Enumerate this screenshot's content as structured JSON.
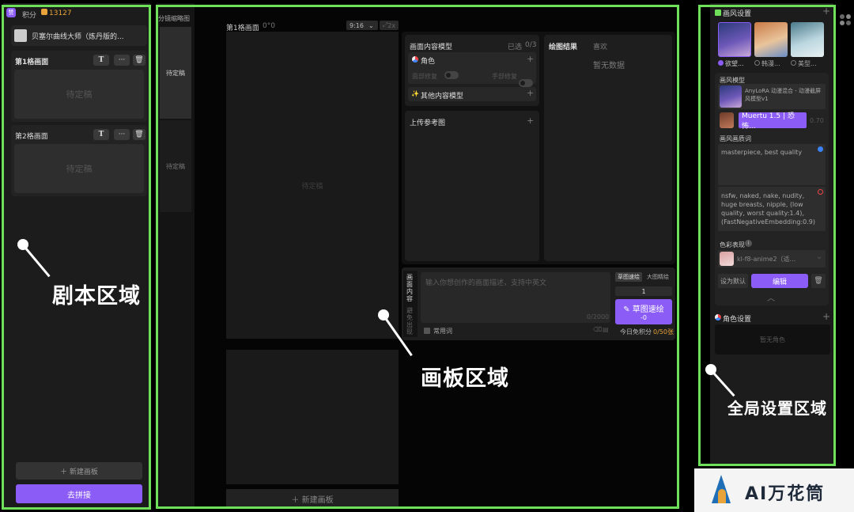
{
  "left": {
    "points_label": "积分",
    "points_value": "13127",
    "script_title": "贝塞尔曲线大师（炼丹版的...",
    "panel1_title": "第1格画面",
    "panel2_title": "第2格画面",
    "pending": "待定稿",
    "new_board": "＋ 新建画板",
    "stitch": "去拼接"
  },
  "storyboard": {
    "tab_label": "分镜缩略图",
    "item1": "待定稿",
    "item2": "待定稿"
  },
  "canvas": {
    "title": "第1格画面",
    "title_suffix": "0°0",
    "ratio": "9:16",
    "zoom": "2x",
    "pending": "待定稿",
    "new_board": "＋  新建画板"
  },
  "content_model": {
    "title": "画面内容模型",
    "selected": "已选",
    "count": "0/3",
    "role": "角色",
    "face_fix": "面部修复",
    "hand_fix": "手部修复",
    "other": "其他内容模型"
  },
  "upload": {
    "title": "上传参考图"
  },
  "results": {
    "title": "绘图结果",
    "fav": "喜欢",
    "empty": "暂无数据"
  },
  "prompt": {
    "side_tab1": "画面内容",
    "side_tab2": "避免出现",
    "placeholder": "输入你想创作的画面描述，支持中英文",
    "counter": "0/2000",
    "common_words": "常用词",
    "mode1": "草图速绘",
    "mode2": "大图精绘",
    "quantity": "1",
    "generate": "草图速绘",
    "generate_cost": "-0",
    "daily": "今日免积分",
    "daily_value": "0/50张"
  },
  "global": {
    "style_title": "画风设置",
    "style_opts": [
      "欲望...",
      "韩漫...",
      "美型..."
    ],
    "model_title": "画风模型",
    "model_name": "AnyLoRA 动漫混合 - 动漫截屏风模型v1",
    "lora_name": "Muertu 1.5 | 恐怖...",
    "lora_weight": "0.70",
    "quality_title": "画风画质词",
    "positive": "masterpiece, best quality",
    "negative": "nsfw, naked, nake, nudity, huge breasts, nipple, (low quality, worst quality:1.4), (FastNegativeEmbedding:0.9)",
    "color_title": "色彩表现",
    "color_value": "kl-f8-anime2（适...",
    "set_default": "设为默认",
    "edit": "编辑",
    "role_title": "角色设置",
    "role_empty": "暂无角色"
  },
  "annotations": {
    "script_area": "剧本区域",
    "canvas_area": "画板区域",
    "global_area": "全局设置区域"
  },
  "watermark": "AI万花筒"
}
